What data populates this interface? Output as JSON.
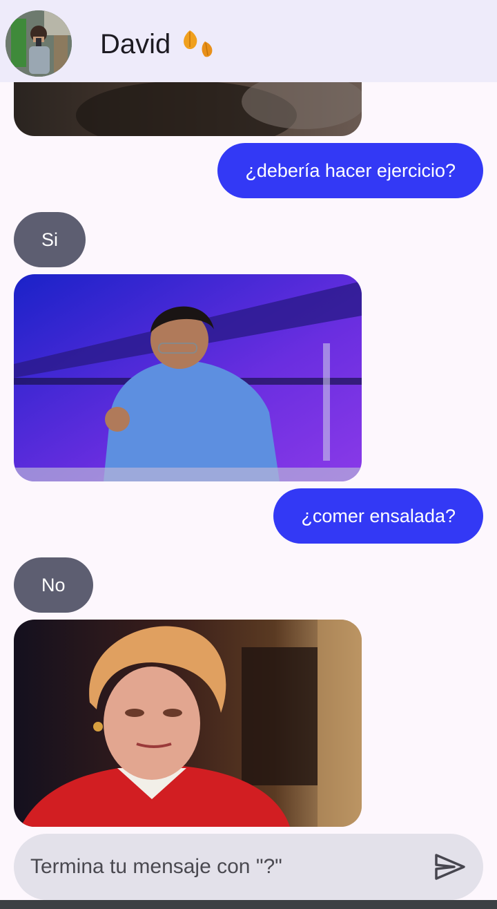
{
  "header": {
    "contact_name": "David",
    "status_icon": "falling-leaves-icon",
    "avatar_icon": "profile-photo"
  },
  "messages": [
    {
      "type": "gif",
      "side": "received",
      "description_icon": "partial-gif-image"
    },
    {
      "type": "text",
      "side": "sent",
      "text": "¿debería hacer ejercicio?"
    },
    {
      "type": "text",
      "side": "received",
      "text": "Si"
    },
    {
      "type": "gif",
      "side": "received",
      "description_icon": "man-fist-pump-gif"
    },
    {
      "type": "text",
      "side": "sent",
      "text": "¿comer ensalada?"
    },
    {
      "type": "text",
      "side": "received",
      "text": "No"
    },
    {
      "type": "gif",
      "side": "received",
      "description_icon": "woman-unimpressed-gif"
    }
  ],
  "composer": {
    "placeholder": "Termina tu mensaje con \"?\"",
    "value": "",
    "send_icon": "send-icon"
  },
  "colors": {
    "appbar": "#eeebfa",
    "background": "#fdf7fd",
    "sent_bubble": "#3339f5",
    "received_bubble": "#5d5e71",
    "input": "#e3e1ea"
  }
}
